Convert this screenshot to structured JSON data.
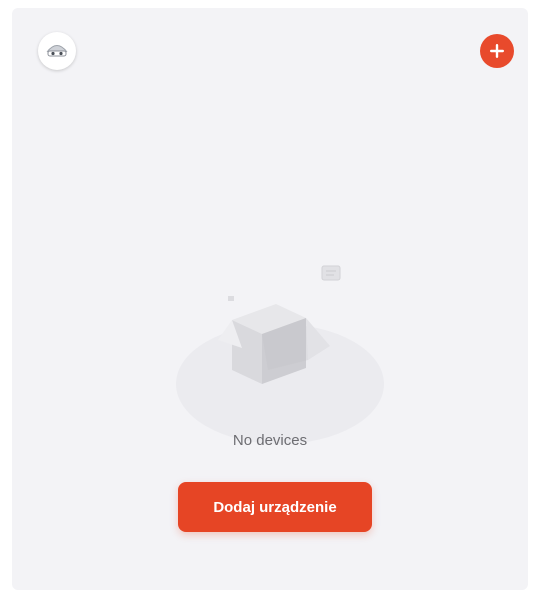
{
  "header": {
    "avatar_icon": "user-avatar-icon",
    "add_button_icon": "plus-icon"
  },
  "empty_state": {
    "illustration_icon": "empty-box-icon",
    "message": "No devices",
    "action_label": "Dodaj urządzenie"
  },
  "colors": {
    "accent": "#e64525",
    "background": "#f3f3f6",
    "text_muted": "#6d6d72"
  }
}
